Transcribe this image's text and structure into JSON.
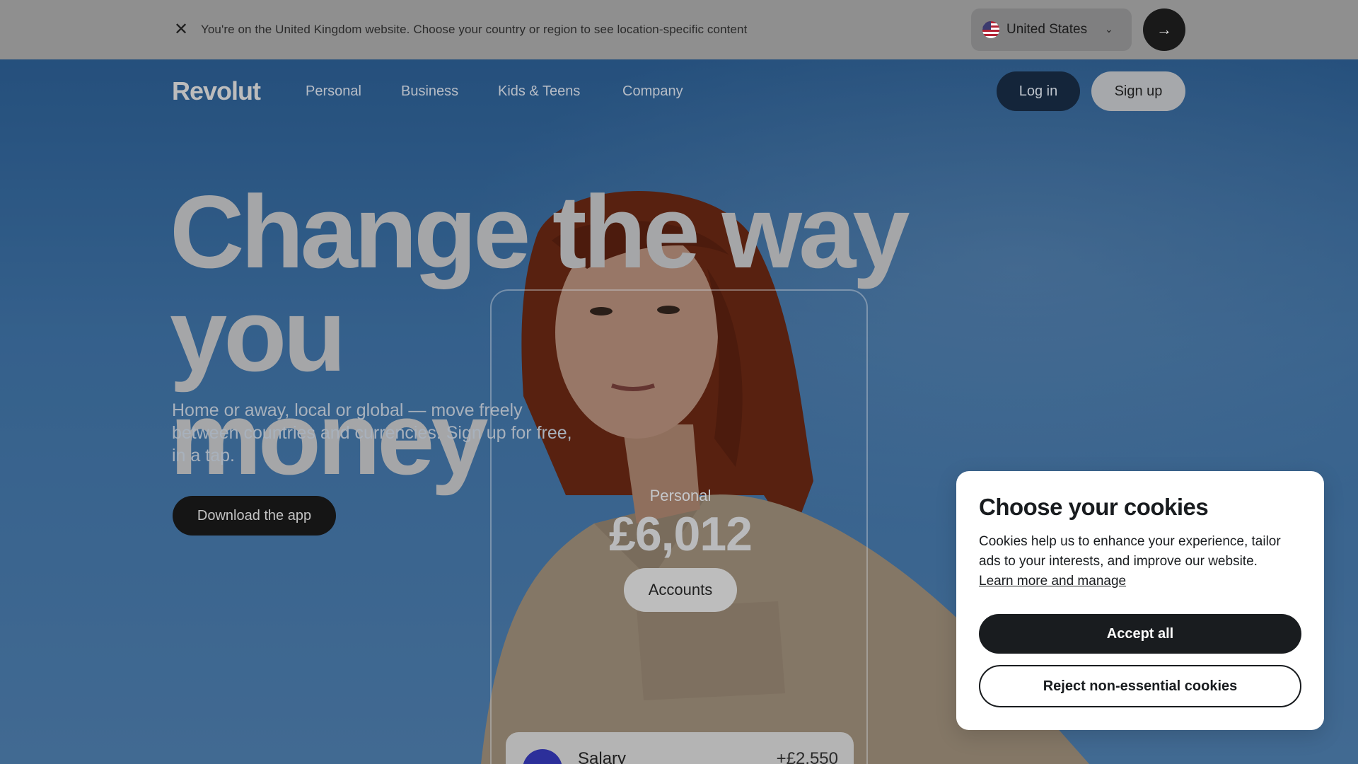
{
  "country_banner": {
    "message": "You're on the United Kingdom website. Choose your country or region to see location-specific content",
    "selected_country": "United States"
  },
  "nav": {
    "logo": "Revolut",
    "items": [
      "Personal",
      "Business",
      "Kids & Teens",
      "Company"
    ],
    "login": "Log in",
    "signup": "Sign up"
  },
  "hero": {
    "title_line1": "Change the way you",
    "title_line2": "money",
    "subtitle": "Home or away, local or global — move freely between countries and currencies. Sign up for free, in a tap.",
    "cta": "Download the app"
  },
  "phone": {
    "account_label": "Personal",
    "balance": "£6,012",
    "accounts_button": "Accounts",
    "transaction": {
      "name": "Salary",
      "amount": "+£2,550"
    }
  },
  "cookies": {
    "title": "Choose your cookies",
    "body": "Cookies help us to enhance your experience, tailor ads to your interests, and improve our website.",
    "link": "Learn more and manage",
    "accept": "Accept all",
    "reject": "Reject non-essential cookies"
  },
  "colors": {
    "banner_bg": "#8f8f8f",
    "sky": "#3f78b4",
    "hair": "#7a2e17",
    "jacket": "#b8a58e",
    "dark": "#191c1f"
  }
}
